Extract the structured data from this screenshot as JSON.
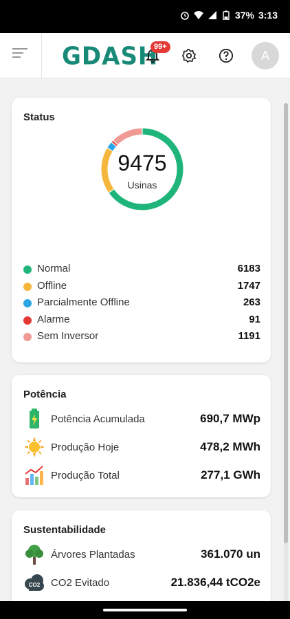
{
  "status_bar": {
    "battery": "37%",
    "time": "3:13"
  },
  "app_bar": {
    "logo": "GDASH",
    "notification_badge": "99+",
    "avatar_initial": "A"
  },
  "status_card": {
    "title": "Status",
    "total": "9475",
    "total_label": "Usinas",
    "items": [
      {
        "label": "Normal",
        "value": "6183",
        "color": "#1fb57a"
      },
      {
        "label": "Offline",
        "value": "1747",
        "color": "#f4b63b"
      },
      {
        "label": "Parcialmente Offline",
        "value": "263",
        "color": "#2aa5e6"
      },
      {
        "label": "Alarme",
        "value": "91",
        "color": "#e53935"
      },
      {
        "label": "Sem Inversor",
        "value": "1191",
        "color": "#ef9a94"
      }
    ]
  },
  "potencia_card": {
    "title": "Potência",
    "items": [
      {
        "label": "Potência Acumulada",
        "value": "690,7 MWp",
        "icon": "battery-icon"
      },
      {
        "label": "Produção Hoje",
        "value": "478,2 MWh",
        "icon": "sun-icon"
      },
      {
        "label": "Produção Total",
        "value": "277,1 GWh",
        "icon": "chart-icon"
      }
    ]
  },
  "sustentabilidade_card": {
    "title": "Sustentabilidade",
    "items": [
      {
        "label": "Árvores Plantadas",
        "value": "361.070 un",
        "icon": "tree-icon"
      },
      {
        "label": "CO2 Evitado",
        "value": "21.836,44 tCO2e",
        "icon": "co2-cloud-icon",
        "icon_text": "CO2"
      }
    ]
  }
}
